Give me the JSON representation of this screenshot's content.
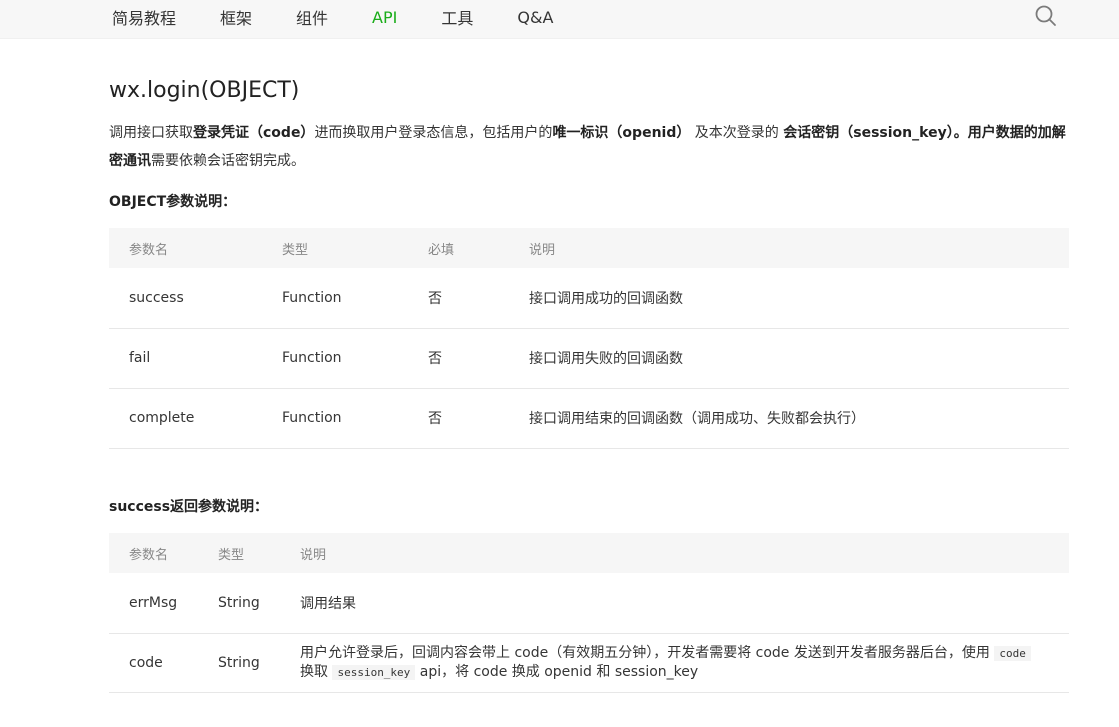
{
  "nav": {
    "items": [
      "简易教程",
      "框架",
      "组件",
      "API",
      "工具",
      "Q&A"
    ],
    "active_index": 3,
    "search_icon": "search-icon",
    "active_color": "#1aad19"
  },
  "page": {
    "title": "wx.login(OBJECT)",
    "description": {
      "p1": "调用接口获取",
      "b1": "登录凭证（code）",
      "p2": "进而换取用户登录态信息，包括用户的",
      "b2": "唯一标识（openid）",
      "p3": " 及本次登录的 ",
      "b3": "会话密钥（session_key）。用户数据的加解密通讯",
      "p4": "需要依赖会话密钥完成。"
    }
  },
  "object_params": {
    "title": "OBJECT参数说明：",
    "headers": [
      "参数名",
      "类型",
      "必填",
      "说明"
    ],
    "rows": [
      {
        "name": "success",
        "type": "Function",
        "required": "否",
        "desc": "接口调用成功的回调函数"
      },
      {
        "name": "fail",
        "type": "Function",
        "required": "否",
        "desc": "接口调用失败的回调函数"
      },
      {
        "name": "complete",
        "type": "Function",
        "required": "否",
        "desc": "接口调用结束的回调函数（调用成功、失败都会执行）"
      }
    ]
  },
  "success_params": {
    "title": "success返回参数说明：",
    "headers": [
      "参数名",
      "类型",
      "说明"
    ],
    "rows": [
      {
        "name": "errMsg",
        "type": "String",
        "desc": "调用结果"
      },
      {
        "name": "code",
        "type": "String",
        "desc_p1": "用户允许登录后，回调内容会带上 code（有效期五分钟），开发者需要将 code 发送到开发者服务器后台，使用 ",
        "desc_code1": "code",
        "desc_p2": " 换取 ",
        "desc_code2": "session_key",
        "desc_p3": " api，将 code 换成 openid 和 session_key"
      }
    ]
  }
}
